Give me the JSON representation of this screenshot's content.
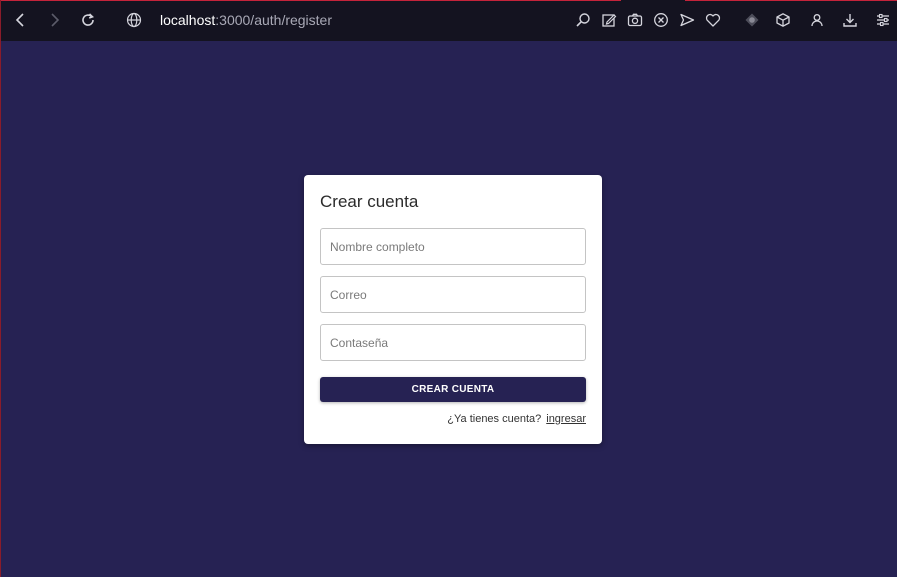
{
  "browser": {
    "url_host": "localhost",
    "url_path": ":3000/auth/register",
    "icons": {
      "back": "back-arrow-icon",
      "forward": "forward-arrow-icon",
      "reload": "reload-icon",
      "site": "globe-icon",
      "tools": [
        "search-zoom-icon",
        "edit-icon",
        "camera-icon",
        "block-icon",
        "send-icon",
        "heart-icon",
        "extension-icon",
        "cube-icon",
        "profile-icon",
        "download-icon",
        "settings-icon"
      ]
    }
  },
  "register_form": {
    "title": "Crear cuenta",
    "fields": {
      "name_placeholder": "Nombre completo",
      "name_value": "",
      "email_placeholder": "Correo",
      "email_value": "",
      "password_placeholder": "Contaseña",
      "password_value": ""
    },
    "submit_label": "CREAR CUENTA",
    "login_prompt": "¿Ya tienes cuenta?",
    "login_link": "ingresar"
  },
  "colors": {
    "page_background": "#262253",
    "button_background": "#262253",
    "browser_bar": "#141320",
    "accent": "#c4233a"
  }
}
